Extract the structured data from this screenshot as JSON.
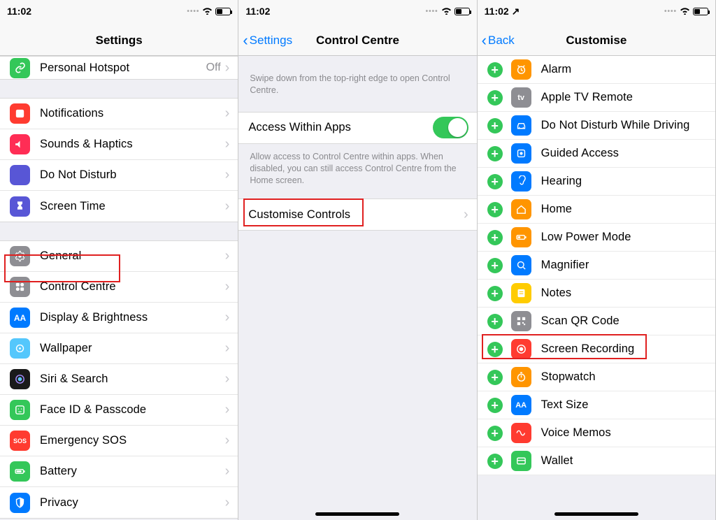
{
  "status": {
    "time": "11:02",
    "loc": "↗"
  },
  "pane1": {
    "title": "Settings",
    "first": {
      "label": "Personal Hotspot",
      "value": "Off",
      "icon_bg": "#34c759",
      "icon": "link-icon"
    },
    "group_a": [
      {
        "label": "Notifications",
        "icon_bg": "#ff3b30",
        "icon": "notifications-icon"
      },
      {
        "label": "Sounds & Haptics",
        "icon_bg": "#ff2d55",
        "icon": "sounds-icon"
      },
      {
        "label": "Do Not Disturb",
        "icon_bg": "#5856d6",
        "icon": "dnd-icon"
      },
      {
        "label": "Screen Time",
        "icon_bg": "#5856d6",
        "icon": "screentime-icon"
      }
    ],
    "group_b": [
      {
        "label": "General",
        "icon_bg": "#8e8e93",
        "icon": "gear-icon"
      },
      {
        "label": "Control Centre",
        "icon_bg": "#8e8e93",
        "icon": "controlcentre-icon"
      },
      {
        "label": "Display & Brightness",
        "icon_bg": "#007aff",
        "icon": "display-icon"
      },
      {
        "label": "Wallpaper",
        "icon_bg": "#54c7fc",
        "icon": "wallpaper-icon"
      },
      {
        "label": "Siri & Search",
        "icon_bg": "#1a1a1a",
        "icon": "siri-icon"
      },
      {
        "label": "Face ID & Passcode",
        "icon_bg": "#34c759",
        "icon": "faceid-icon"
      },
      {
        "label": "Emergency SOS",
        "icon_bg": "#ff3b30",
        "icon": "sos-icon",
        "icon_text": "SOS"
      },
      {
        "label": "Battery",
        "icon_bg": "#34c759",
        "icon": "battery-icon"
      },
      {
        "label": "Privacy",
        "icon_bg": "#007aff",
        "icon": "privacy-icon"
      }
    ]
  },
  "pane2": {
    "back": "Settings",
    "title": "Control Centre",
    "intro": "Swipe down from the top-right edge to open Control Centre.",
    "row_switch": "Access Within Apps",
    "switch_on": true,
    "footer": "Allow access to Control Centre within apps. When disabled, you can still access Control Centre from the Home screen.",
    "row_customise": "Customise Controls"
  },
  "pane3": {
    "back": "Back",
    "title": "Customise",
    "items": [
      {
        "label": "Alarm",
        "icon_bg": "#ff9500",
        "icon": "alarm-icon"
      },
      {
        "label": "Apple TV Remote",
        "icon_bg": "#8e8e93",
        "icon": "appletv-icon",
        "icon_text": "tv"
      },
      {
        "label": "Do Not Disturb While Driving",
        "icon_bg": "#007aff",
        "icon": "car-icon"
      },
      {
        "label": "Guided Access",
        "icon_bg": "#007aff",
        "icon": "guidedaccess-icon"
      },
      {
        "label": "Hearing",
        "icon_bg": "#007aff",
        "icon": "hearing-icon"
      },
      {
        "label": "Home",
        "icon_bg": "#ff9500",
        "icon": "home-icon"
      },
      {
        "label": "Low Power Mode",
        "icon_bg": "#ff9500",
        "icon": "lowpower-icon"
      },
      {
        "label": "Magnifier",
        "icon_bg": "#007aff",
        "icon": "magnifier-icon"
      },
      {
        "label": "Notes",
        "icon_bg": "#ffcc00",
        "icon": "notes-icon"
      },
      {
        "label": "Scan QR Code",
        "icon_bg": "#8e8e93",
        "icon": "qrcode-icon"
      },
      {
        "label": "Screen Recording",
        "icon_bg": "#ff3b30",
        "icon": "record-icon"
      },
      {
        "label": "Stopwatch",
        "icon_bg": "#ff9500",
        "icon": "stopwatch-icon"
      },
      {
        "label": "Text Size",
        "icon_bg": "#007aff",
        "icon": "textsize-icon",
        "icon_text": "AA"
      },
      {
        "label": "Voice Memos",
        "icon_bg": "#ff3b30",
        "icon": "voicememos-icon"
      },
      {
        "label": "Wallet",
        "icon_bg": "#34c759",
        "icon": "wallet-icon"
      }
    ]
  }
}
